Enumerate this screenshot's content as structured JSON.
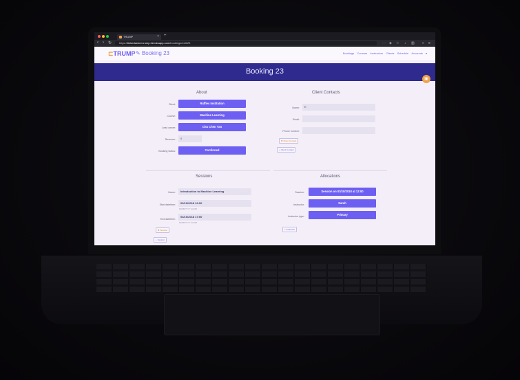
{
  "browser": {
    "tab_title": "TRUMP",
    "url_prefix": "https://",
    "url_host": "tinkertanker-trump.herokuapp.com",
    "url_path": "/bookings/edit/23"
  },
  "app": {
    "logo_text": "TRUMP",
    "breadcrumb": "Booking 23",
    "nav_links": [
      "Bookings",
      "Courses",
      "Instructors",
      "Clients",
      "Schedule",
      "Accounts"
    ],
    "page_title": "Booking 23"
  },
  "about": {
    "title": "About",
    "client_label": "Client:",
    "client_value": "Raffles Institution",
    "course_label": "Course:",
    "course_value": "Machine Learning",
    "lead_owner_label": "Lead owner:",
    "lead_owner_value": "Chu Chen Yan",
    "revenue_label": "Revenue:",
    "revenue_value": "0",
    "booking_status_label": "Booking status:",
    "booking_status_value": "Confirmed"
  },
  "client_contacts": {
    "title": "Client Contacts",
    "name_label": "Name:",
    "name_value": "E",
    "email_label": "Email:",
    "phone_label": "Phone number:",
    "remove_contact": "Client Contact",
    "add_contact": "Client Contact"
  },
  "sessions": {
    "title": "Sessions",
    "name_label": "Name:",
    "name_value": "Introduction to Machine Learning",
    "start_label": "Start datetime:",
    "start_value": "03/10/2018 12:00",
    "start_hint": "DD/MM/YYYY HH:MM",
    "end_label": "End datetime:",
    "end_value": "03/10/2018 17:00",
    "end_hint": "DD/MM/YYYY HH:MM",
    "remove_session": "Session",
    "add_session": "Session"
  },
  "allocations": {
    "title": "Allocations",
    "session_label": "Session:",
    "session_value": "Session on 03/10/2018 at 12:00",
    "instructor_label": "Instructor:",
    "instructor_value": "Sarah",
    "instructor_type_label": "Instructor type:",
    "instructor_type_value": "Primary",
    "add_allocation": "Instructor"
  },
  "colors": {
    "primary": "#6d5ff2",
    "hero": "#2e2a8e",
    "accent": "#f0a24a"
  }
}
